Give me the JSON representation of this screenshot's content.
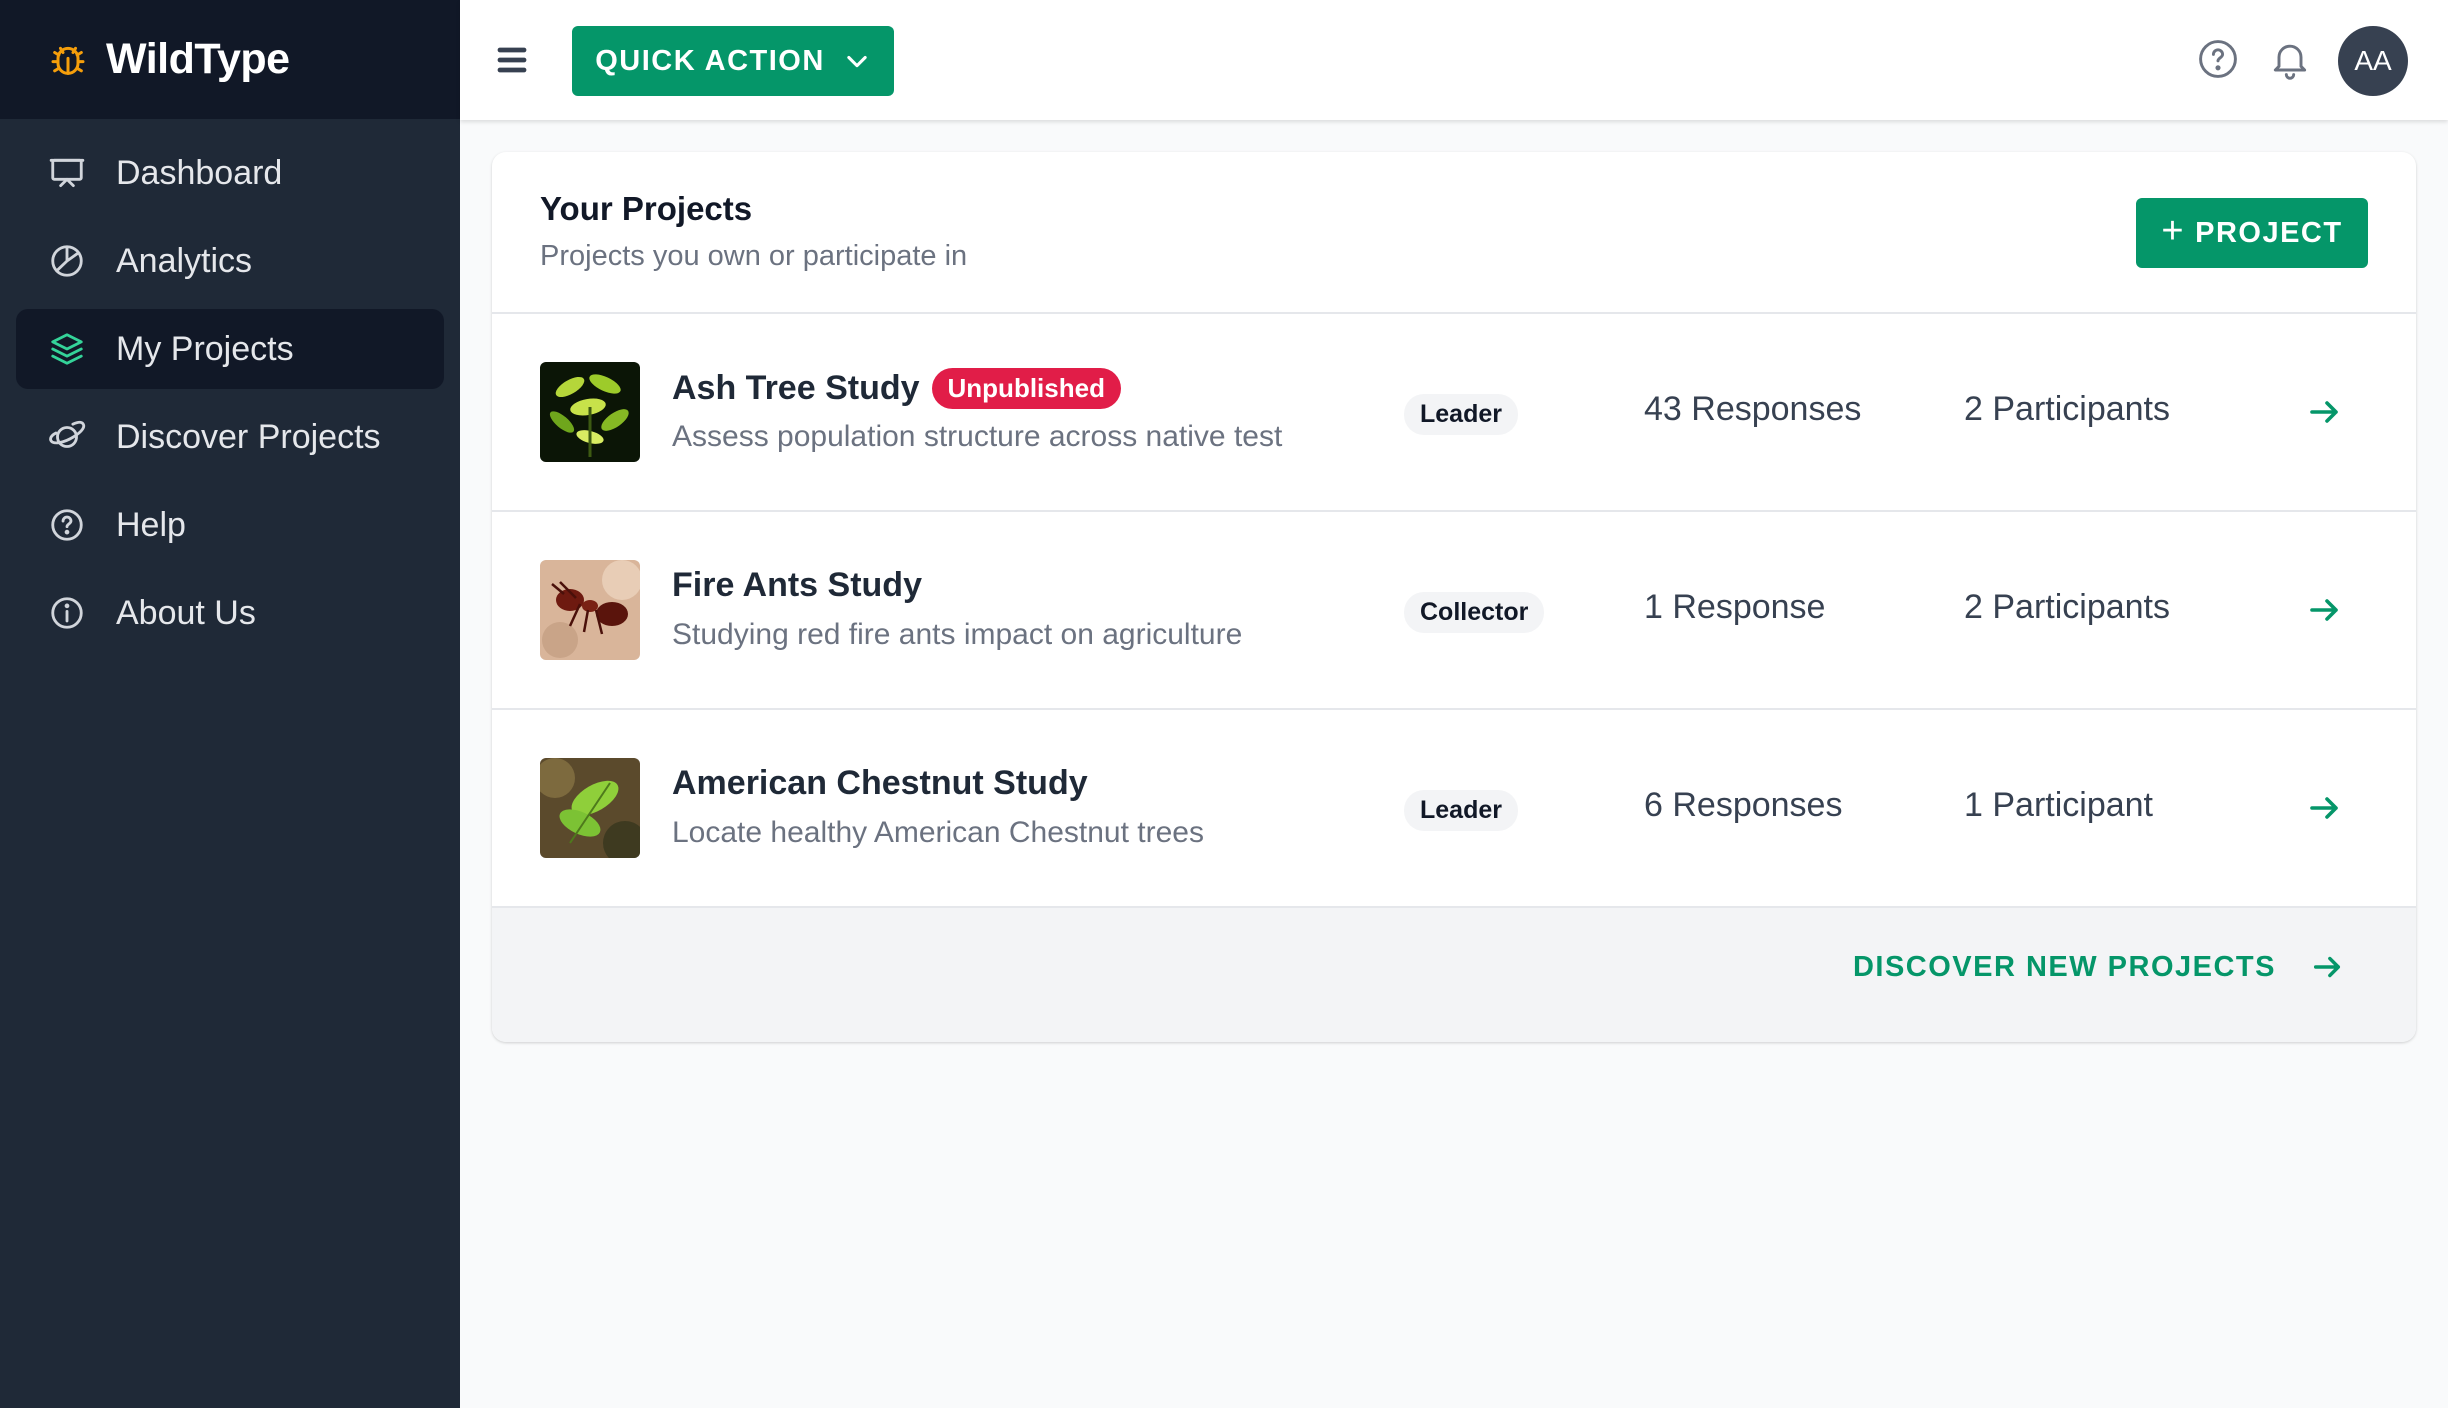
{
  "brand": {
    "name": "WildType"
  },
  "sidebar": {
    "items": [
      {
        "label": "Dashboard",
        "icon": "presentation-icon",
        "active": false
      },
      {
        "label": "Analytics",
        "icon": "pie-chart-icon",
        "active": false
      },
      {
        "label": "My Projects",
        "icon": "layers-icon",
        "active": true
      },
      {
        "label": "Discover Projects",
        "icon": "planet-icon",
        "active": false
      },
      {
        "label": "Help",
        "icon": "question-circle-icon",
        "active": false
      },
      {
        "label": "About Us",
        "icon": "info-circle-icon",
        "active": false
      }
    ]
  },
  "topbar": {
    "quick_action_label": "QUICK ACTION",
    "avatar_initials": "AA"
  },
  "projects_card": {
    "title": "Your Projects",
    "subtitle": "Projects you own or participate in",
    "add_button_label": "PROJECT",
    "rows": [
      {
        "title": "Ash Tree Study",
        "badge": "Unpublished",
        "description": "Assess population structure across native test",
        "role": "Leader",
        "responses": "43 Responses",
        "participants": "2 Participants",
        "thumb": "leaf-thumbnail"
      },
      {
        "title": "Fire Ants Study",
        "badge": "",
        "description": "Studying red fire ants impact on agriculture",
        "role": "Collector",
        "responses": "1 Response",
        "participants": "2 Participants",
        "thumb": "ant-thumbnail"
      },
      {
        "title": "American Chestnut Study",
        "badge": "",
        "description": "Locate healthy American Chestnut trees",
        "role": "Leader",
        "responses": "6 Responses",
        "participants": "1 Participant",
        "thumb": "chestnut-leaf-thumbnail"
      }
    ],
    "footer_link": "DISCOVER NEW PROJECTS"
  },
  "colors": {
    "accent": "#059669",
    "sidebar_bg": "#1f2937",
    "brand_bg": "#111827",
    "badge_unpublished": "#e11d48",
    "logo": "#f59e0b"
  }
}
